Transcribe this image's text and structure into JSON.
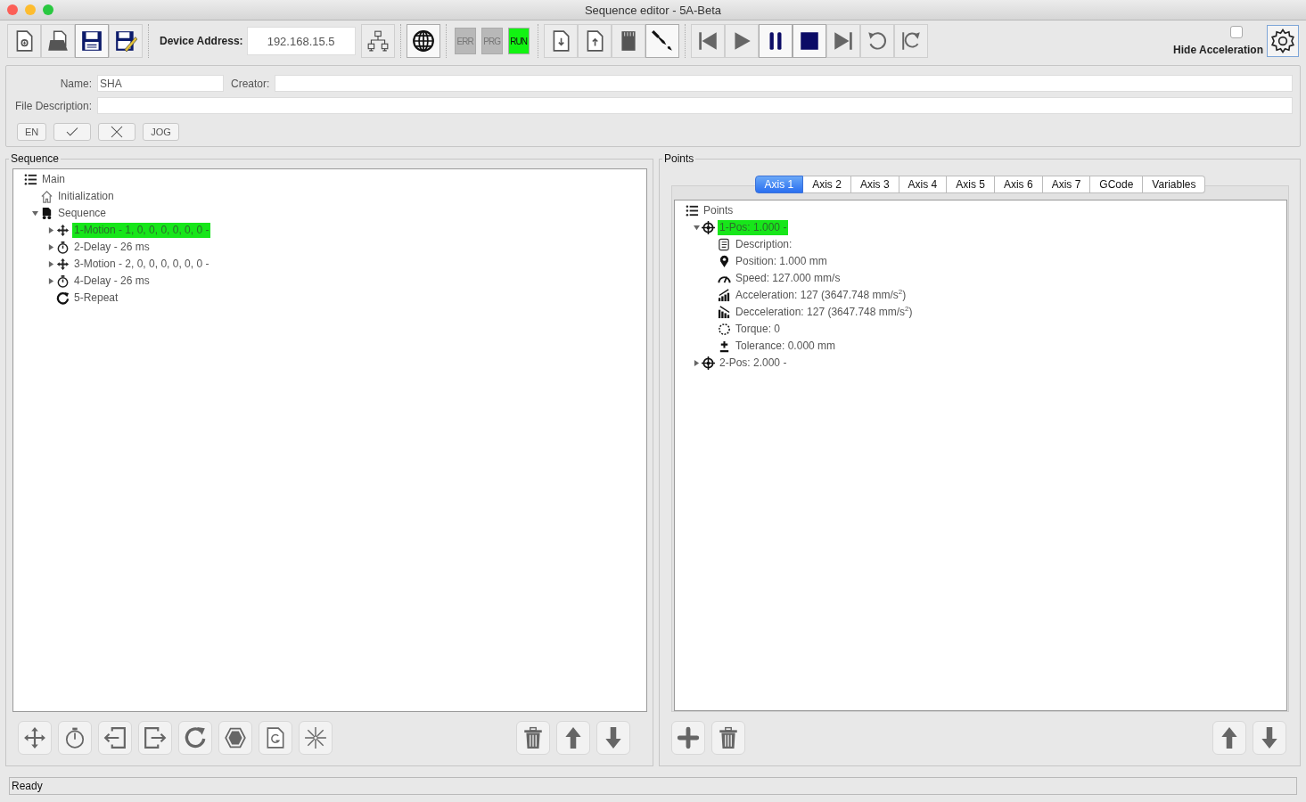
{
  "window": {
    "title": "Sequence editor - 5A-Beta"
  },
  "toolbar": {
    "device_address_label": "Device Address:",
    "device_address": "192.168.15.5",
    "indicators": [
      {
        "label": "ERR",
        "on": false
      },
      {
        "label": "PRG",
        "on": false
      },
      {
        "label": "RUN",
        "on": true
      }
    ],
    "hide_acceleration": {
      "label": "Hide Acceleration",
      "checked": false
    }
  },
  "file": {
    "name_label": "Name:",
    "name": "SHA",
    "creator_label": "Creator:",
    "description_label": "File Description:",
    "en_button": "EN",
    "jog_button": "JOG"
  },
  "sequence": {
    "title": "Sequence",
    "tree": [
      {
        "label": "Main",
        "kind": "list",
        "selected": false,
        "children": [
          {
            "label": "Initialization",
            "kind": "home",
            "selected": false
          },
          {
            "label": "Sequence",
            "kind": "document",
            "selected": false,
            "expanded": true,
            "children": [
              {
                "label": "1-Motion - 1, 0, 0, 0, 0, 0, 0 -",
                "kind": "motion",
                "selected": true,
                "expanded": false
              },
              {
                "label": "2-Delay - 26 ms",
                "kind": "delay",
                "selected": false,
                "expanded": false
              },
              {
                "label": "3-Motion - 2, 0, 0, 0, 0, 0, 0 -",
                "kind": "motion",
                "selected": false,
                "expanded": false
              },
              {
                "label": "4-Delay - 26 ms",
                "kind": "delay",
                "selected": false,
                "expanded": false
              },
              {
                "label": "5-Repeat",
                "kind": "repeat",
                "selected": false
              }
            ]
          }
        ]
      }
    ]
  },
  "points": {
    "title": "Points",
    "tabs": [
      {
        "label": "Axis 1",
        "selected": true
      },
      {
        "label": "Axis 2",
        "selected": false
      },
      {
        "label": "Axis 3",
        "selected": false
      },
      {
        "label": "Axis 4",
        "selected": false
      },
      {
        "label": "Axis 5",
        "selected": false
      },
      {
        "label": "Axis 6",
        "selected": false
      },
      {
        "label": "Axis 7",
        "selected": false
      },
      {
        "label": "GCode",
        "selected": false
      },
      {
        "label": "Variables",
        "selected": false
      }
    ],
    "tree": [
      {
        "label": "Points",
        "kind": "list",
        "selected": false,
        "children": [
          {
            "label": "1-Pos: 1.000 -",
            "kind": "target",
            "selected": true,
            "expanded": true,
            "children": [
              {
                "label": "Description:",
                "kind": "description",
                "selected": false
              },
              {
                "label": "Position: 1.000 mm",
                "kind": "position",
                "selected": false
              },
              {
                "label": "Speed: 127.000 mm/s",
                "kind": "speed",
                "selected": false
              },
              {
                "label": "Acceleration: 127 (3647.748 mm/s$^{2}$)",
                "kind": "acceleration",
                "selected": false
              },
              {
                "label": "Decceleration: 127 (3647.748 mm/s$^{2}$)",
                "kind": "deceleration",
                "selected": false
              },
              {
                "label": "Torque: 0",
                "kind": "torque",
                "selected": false
              },
              {
                "label": "Tolerance: 0.000 mm",
                "kind": "tolerance",
                "selected": false
              }
            ]
          },
          {
            "label": "2-Pos: 2.000 -",
            "kind": "target",
            "selected": false,
            "expanded": false
          }
        ]
      }
    ]
  },
  "status_bar": "Ready"
}
